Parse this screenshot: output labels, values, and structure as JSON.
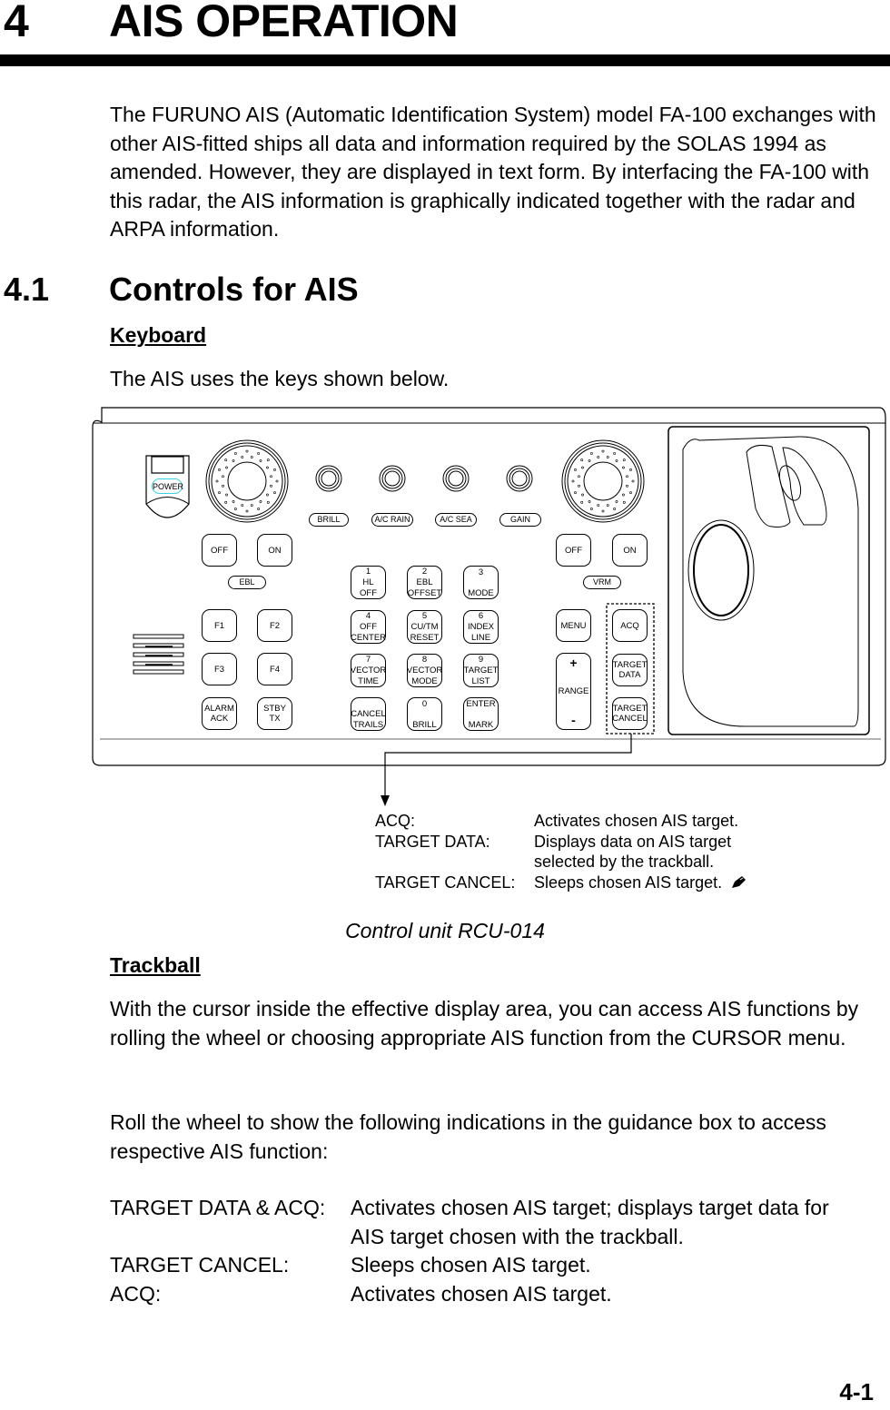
{
  "chapter": {
    "number": "4",
    "title": "AIS OPERATION"
  },
  "intro": "The FURUNO AIS (Automatic Identification System) model FA-100 exchanges with other AIS-fitted ships all data and information required by the SOLAS 1994 as amended. However, they are displayed in text form. By interfacing the FA-100 with this radar, the AIS information is graphically indicated together with the radar and ARPA information.",
  "section": {
    "number": "4.1",
    "title": "Controls for AIS"
  },
  "keyboard": {
    "heading": "Keyboard",
    "text": "The AIS uses the keys shown below.",
    "panel": {
      "power": "POWER",
      "pills": {
        "brill": "BRILL",
        "ac_rain": "A/C RAIN",
        "ac_sea": "A/C SEA",
        "gain": "GAIN",
        "ebl": "EBL",
        "vrm": "VRM"
      },
      "ebl_off": "OFF",
      "ebl_on": "ON",
      "vrm_off": "OFF",
      "vrm_on": "ON",
      "f1": "F1",
      "f2": "F2",
      "f3": "F3",
      "f4": "F4",
      "alarm_ack": [
        "ALARM",
        "ACK"
      ],
      "stby_tx": [
        "STBY",
        "TX"
      ],
      "numpad": [
        [
          "1",
          "HL",
          "OFF"
        ],
        [
          "2",
          "EBL",
          "OFFSET"
        ],
        [
          "3",
          "",
          "MODE"
        ],
        [
          "4",
          "OFF",
          "CENTER"
        ],
        [
          "5",
          "CU/TM",
          "RESET"
        ],
        [
          "6",
          "INDEX",
          "LINE"
        ],
        [
          "7",
          "VECTOR",
          "TIME"
        ],
        [
          "8",
          "VECTOR",
          "MODE"
        ],
        [
          "9",
          "TARGET",
          "LIST"
        ],
        [
          "",
          "CANCEL",
          "TRAILS"
        ],
        [
          "0",
          "",
          "BRILL"
        ],
        [
          "ENTER",
          "",
          "MARK"
        ]
      ],
      "menu": "MENU",
      "range": {
        "plus": "+",
        "label": "RANGE",
        "minus": "-"
      },
      "acq": "ACQ",
      "target_data": [
        "TARGET",
        "DATA"
      ],
      "target_cancel": [
        "TARGET",
        "CANCEL"
      ]
    },
    "annotations": [
      {
        "term": "ACQ:",
        "desc": "Activates chosen AIS target."
      },
      {
        "term": "TARGET DATA:",
        "desc": "Displays data on AIS target"
      },
      {
        "term": "",
        "desc": "selected by the trackball."
      },
      {
        "term": "TARGET CANCEL:",
        "desc": "Sleeps chosen AIS target."
      }
    ],
    "annotation_icon": "pencil-icon",
    "caption": "Control unit RCU-014"
  },
  "trackball": {
    "heading": "Trackball",
    "para1": "With the cursor inside the effective display area, you can access AIS functions by rolling the wheel or choosing appropriate AIS function from the CURSOR menu.",
    "para2": "Roll the wheel to show the following indications in the guidance box to access respective AIS function:",
    "items": [
      {
        "term": "TARGET DATA & ACQ:",
        "desc": "Activates chosen AIS target; displays target data for"
      },
      {
        "term": "",
        "desc": "AIS target chosen with the trackball."
      },
      {
        "term": "TARGET CANCEL:",
        "desc": "Sleeps chosen AIS target."
      },
      {
        "term": "ACQ:",
        "desc": "Activates chosen AIS target."
      }
    ]
  },
  "page_number": "4-1"
}
